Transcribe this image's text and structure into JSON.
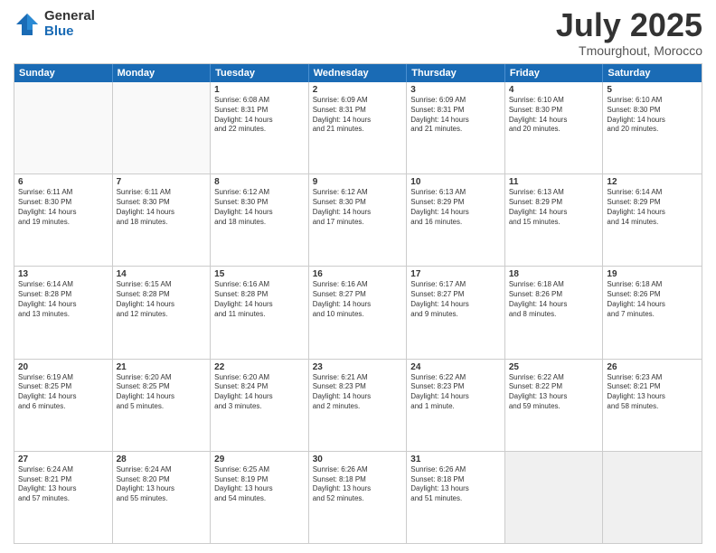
{
  "logo": {
    "general": "General",
    "blue": "Blue"
  },
  "title": {
    "month": "July 2025",
    "location": "Tmourghout, Morocco"
  },
  "calendar": {
    "headers": [
      "Sunday",
      "Monday",
      "Tuesday",
      "Wednesday",
      "Thursday",
      "Friday",
      "Saturday"
    ],
    "rows": [
      [
        {
          "day": "",
          "lines": [],
          "empty": true
        },
        {
          "day": "",
          "lines": [],
          "empty": true
        },
        {
          "day": "1",
          "lines": [
            "Sunrise: 6:08 AM",
            "Sunset: 8:31 PM",
            "Daylight: 14 hours",
            "and 22 minutes."
          ]
        },
        {
          "day": "2",
          "lines": [
            "Sunrise: 6:09 AM",
            "Sunset: 8:31 PM",
            "Daylight: 14 hours",
            "and 21 minutes."
          ]
        },
        {
          "day": "3",
          "lines": [
            "Sunrise: 6:09 AM",
            "Sunset: 8:31 PM",
            "Daylight: 14 hours",
            "and 21 minutes."
          ]
        },
        {
          "day": "4",
          "lines": [
            "Sunrise: 6:10 AM",
            "Sunset: 8:30 PM",
            "Daylight: 14 hours",
            "and 20 minutes."
          ]
        },
        {
          "day": "5",
          "lines": [
            "Sunrise: 6:10 AM",
            "Sunset: 8:30 PM",
            "Daylight: 14 hours",
            "and 20 minutes."
          ]
        }
      ],
      [
        {
          "day": "6",
          "lines": [
            "Sunrise: 6:11 AM",
            "Sunset: 8:30 PM",
            "Daylight: 14 hours",
            "and 19 minutes."
          ]
        },
        {
          "day": "7",
          "lines": [
            "Sunrise: 6:11 AM",
            "Sunset: 8:30 PM",
            "Daylight: 14 hours",
            "and 18 minutes."
          ]
        },
        {
          "day": "8",
          "lines": [
            "Sunrise: 6:12 AM",
            "Sunset: 8:30 PM",
            "Daylight: 14 hours",
            "and 18 minutes."
          ]
        },
        {
          "day": "9",
          "lines": [
            "Sunrise: 6:12 AM",
            "Sunset: 8:30 PM",
            "Daylight: 14 hours",
            "and 17 minutes."
          ]
        },
        {
          "day": "10",
          "lines": [
            "Sunrise: 6:13 AM",
            "Sunset: 8:29 PM",
            "Daylight: 14 hours",
            "and 16 minutes."
          ]
        },
        {
          "day": "11",
          "lines": [
            "Sunrise: 6:13 AM",
            "Sunset: 8:29 PM",
            "Daylight: 14 hours",
            "and 15 minutes."
          ]
        },
        {
          "day": "12",
          "lines": [
            "Sunrise: 6:14 AM",
            "Sunset: 8:29 PM",
            "Daylight: 14 hours",
            "and 14 minutes."
          ]
        }
      ],
      [
        {
          "day": "13",
          "lines": [
            "Sunrise: 6:14 AM",
            "Sunset: 8:28 PM",
            "Daylight: 14 hours",
            "and 13 minutes."
          ]
        },
        {
          "day": "14",
          "lines": [
            "Sunrise: 6:15 AM",
            "Sunset: 8:28 PM",
            "Daylight: 14 hours",
            "and 12 minutes."
          ]
        },
        {
          "day": "15",
          "lines": [
            "Sunrise: 6:16 AM",
            "Sunset: 8:28 PM",
            "Daylight: 14 hours",
            "and 11 minutes."
          ]
        },
        {
          "day": "16",
          "lines": [
            "Sunrise: 6:16 AM",
            "Sunset: 8:27 PM",
            "Daylight: 14 hours",
            "and 10 minutes."
          ]
        },
        {
          "day": "17",
          "lines": [
            "Sunrise: 6:17 AM",
            "Sunset: 8:27 PM",
            "Daylight: 14 hours",
            "and 9 minutes."
          ]
        },
        {
          "day": "18",
          "lines": [
            "Sunrise: 6:18 AM",
            "Sunset: 8:26 PM",
            "Daylight: 14 hours",
            "and 8 minutes."
          ]
        },
        {
          "day": "19",
          "lines": [
            "Sunrise: 6:18 AM",
            "Sunset: 8:26 PM",
            "Daylight: 14 hours",
            "and 7 minutes."
          ]
        }
      ],
      [
        {
          "day": "20",
          "lines": [
            "Sunrise: 6:19 AM",
            "Sunset: 8:25 PM",
            "Daylight: 14 hours",
            "and 6 minutes."
          ]
        },
        {
          "day": "21",
          "lines": [
            "Sunrise: 6:20 AM",
            "Sunset: 8:25 PM",
            "Daylight: 14 hours",
            "and 5 minutes."
          ]
        },
        {
          "day": "22",
          "lines": [
            "Sunrise: 6:20 AM",
            "Sunset: 8:24 PM",
            "Daylight: 14 hours",
            "and 3 minutes."
          ]
        },
        {
          "day": "23",
          "lines": [
            "Sunrise: 6:21 AM",
            "Sunset: 8:23 PM",
            "Daylight: 14 hours",
            "and 2 minutes."
          ]
        },
        {
          "day": "24",
          "lines": [
            "Sunrise: 6:22 AM",
            "Sunset: 8:23 PM",
            "Daylight: 14 hours",
            "and 1 minute."
          ]
        },
        {
          "day": "25",
          "lines": [
            "Sunrise: 6:22 AM",
            "Sunset: 8:22 PM",
            "Daylight: 13 hours",
            "and 59 minutes."
          ]
        },
        {
          "day": "26",
          "lines": [
            "Sunrise: 6:23 AM",
            "Sunset: 8:21 PM",
            "Daylight: 13 hours",
            "and 58 minutes."
          ]
        }
      ],
      [
        {
          "day": "27",
          "lines": [
            "Sunrise: 6:24 AM",
            "Sunset: 8:21 PM",
            "Daylight: 13 hours",
            "and 57 minutes."
          ]
        },
        {
          "day": "28",
          "lines": [
            "Sunrise: 6:24 AM",
            "Sunset: 8:20 PM",
            "Daylight: 13 hours",
            "and 55 minutes."
          ]
        },
        {
          "day": "29",
          "lines": [
            "Sunrise: 6:25 AM",
            "Sunset: 8:19 PM",
            "Daylight: 13 hours",
            "and 54 minutes."
          ]
        },
        {
          "day": "30",
          "lines": [
            "Sunrise: 6:26 AM",
            "Sunset: 8:18 PM",
            "Daylight: 13 hours",
            "and 52 minutes."
          ]
        },
        {
          "day": "31",
          "lines": [
            "Sunrise: 6:26 AM",
            "Sunset: 8:18 PM",
            "Daylight: 13 hours",
            "and 51 minutes."
          ]
        },
        {
          "day": "",
          "lines": [],
          "empty": true,
          "shaded": true
        },
        {
          "day": "",
          "lines": [],
          "empty": true,
          "shaded": true
        }
      ]
    ]
  }
}
